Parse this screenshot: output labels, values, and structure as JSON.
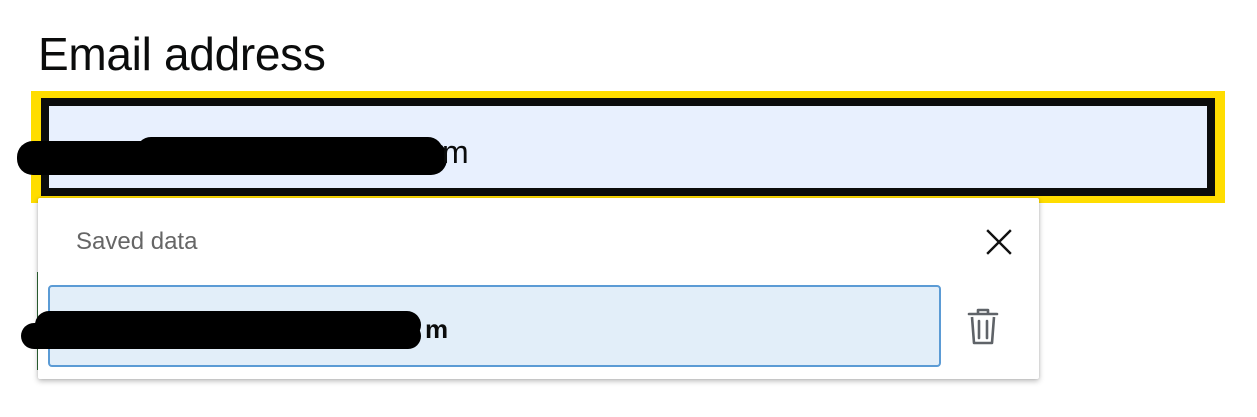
{
  "form": {
    "email_label": "Email address",
    "email_value_visible_suffix": "m"
  },
  "autofill": {
    "heading": "Saved data",
    "saved_value_visible_suffix": "m"
  },
  "icons": {
    "close": "close-icon",
    "delete": "trash-icon"
  },
  "colors": {
    "focus_ring": "#ffdd00",
    "field_border": "#0b0c0c",
    "autofill_background": "#e8f0fe",
    "selected_item_background": "#e2eef9",
    "selected_item_border": "#5b9bd5"
  }
}
